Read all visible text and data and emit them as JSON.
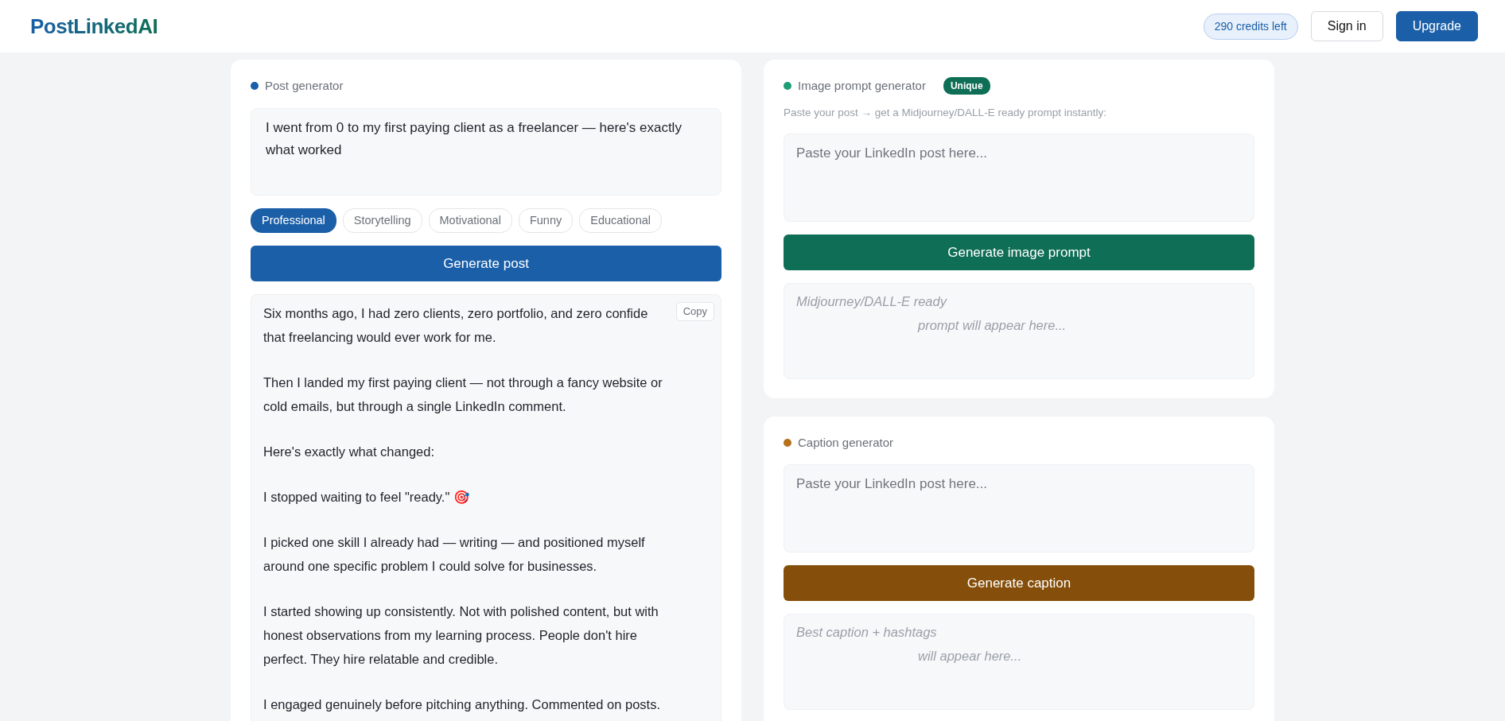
{
  "header": {
    "logo": "PostLinkedAI",
    "credits": "290 credits left",
    "buttons": [
      {
        "label": "Sign in",
        "kind": "outline"
      },
      {
        "label": "Upgrade",
        "kind": "primary"
      }
    ]
  },
  "generators": [
    {
      "kind": "post",
      "title": "Post generator",
      "color": "#1a5fa8",
      "topic": "I went from 0 to my first paying client as a freelancer — here's exactly what worked",
      "tones": [
        {
          "label": "Professional",
          "selected": true
        },
        {
          "label": "Storytelling",
          "selected": false
        },
        {
          "label": "Motivational",
          "selected": false
        },
        {
          "label": "Funny",
          "selected": false
        },
        {
          "label": "Educational",
          "selected": false
        }
      ],
      "button": "Generate post",
      "copy_button": "Copy",
      "output": [
        [
          "Six months ago, I had zero clients, zero portfolio, and zero confide",
          "that freelancing would ever work for me."
        ],
        [
          "Then I landed my first paying client — not through a fancy website or",
          "cold emails, but through a single LinkedIn comment."
        ],
        [
          "Here's exactly what changed:"
        ],
        [
          "I stopped waiting to feel \"ready.\" 🎯"
        ],
        [
          "I picked one skill I already had — writing — and positioned myself",
          "around one specific problem I could solve for businesses."
        ],
        [
          "I started showing up consistently. Not with polished content, but with",
          "honest observations from my learning process. People don't hire",
          "perfect. They hire relatable and credible."
        ],
        [
          "I engaged genuinely before pitching anything. Commented on posts."
        ]
      ]
    },
    {
      "kind": "image_prompt",
      "title": "Image prompt generator",
      "color": "#1d9e75",
      "badge": "Unique",
      "hint": "Paste your post → get a Midjourney/DALL-E ready prompt instantly:",
      "placeholder": "Paste your LinkedIn post here...",
      "button": "Generate image prompt",
      "output_placeholder": [
        "Midjourney/DALL-E ready",
        "prompt will appear here..."
      ]
    },
    {
      "kind": "caption",
      "title": "Caption generator",
      "color": "#b8711b",
      "placeholder": "Paste your LinkedIn post here...",
      "button": "Generate caption",
      "output_placeholder": [
        "Best caption + hashtags",
        "will appear here..."
      ]
    }
  ]
}
